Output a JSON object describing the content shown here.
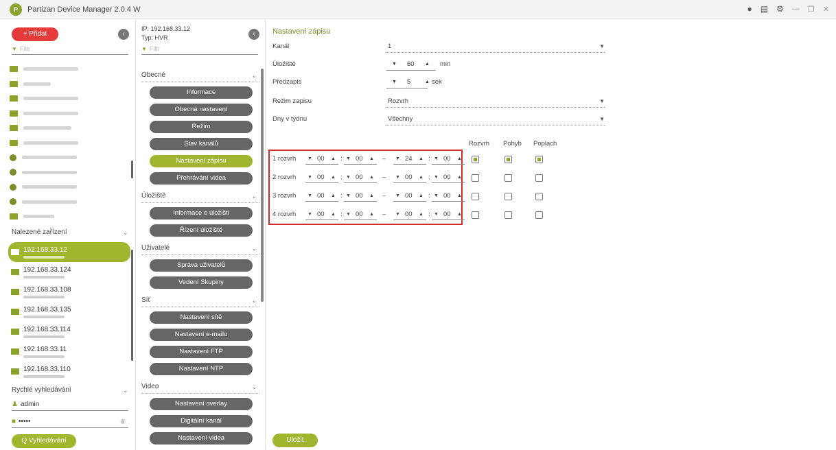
{
  "titlebar": {
    "logo_text": "P",
    "title": "Partizan Device Manager 2.0.4 W"
  },
  "left": {
    "add_label": "+  Přidat",
    "filter_placeholder": "Filtr",
    "found_title": "Nalezené zařízení",
    "found": [
      {
        "ip": "192.168.33.12"
      },
      {
        "ip": "192.168.33.124"
      },
      {
        "ip": "192.168.33.108"
      },
      {
        "ip": "192.168.33.135"
      },
      {
        "ip": "192.168.33.114"
      },
      {
        "ip": "192.168.33.11"
      },
      {
        "ip": "192.168.33.110"
      }
    ],
    "quick_title": "Rychlé vyhledávání",
    "username": "admin",
    "password_mask": "•••••",
    "search_label": "Q  Vyhledávání"
  },
  "middle": {
    "ip_line": "IP:    192.168.33.12",
    "type_line": "Typ:   HVR",
    "filter_placeholder": "Filtr",
    "groups": {
      "obecne": "Obecné",
      "uloziste": "Úložiště",
      "uzivatele": "Uživatelé",
      "sit": "Síť",
      "video": "Video"
    },
    "buttons": {
      "informace": "Informace",
      "obecna": "Obecná nastavení",
      "rezim": "Režim",
      "stav": "Stav kanálů",
      "zapisu": "Nastavení zápisu",
      "prehravani": "Přehrávání videa",
      "info_ulozisti": "Informace o úložišti",
      "rizeni": "Řízení úložiště",
      "sprava": "Správa uživatelů",
      "skupiny": "Vedení Skupiny",
      "site": "Nastavení sítě",
      "email": "Nastavení e-mailu",
      "ftp": "Nastavení FTP",
      "ntp": "Nastavení NTP",
      "overlay": "Nastavení overlay",
      "digital": "Digitální kanál",
      "video_set": "Nastavení videa"
    }
  },
  "main": {
    "title": "Nastavení zápisu",
    "kanal_label": "Kanál",
    "kanal_value": "1",
    "uloziste_label": "Úložiště",
    "uloziste_value": "60",
    "uloziste_unit": "min",
    "predzapis_label": "Předzapis",
    "predzapis_value": "5",
    "predzapis_unit": "sek",
    "rezim_label": "Režim zapisu",
    "rezim_value": "Rozvrh",
    "dny_label": "Dny v týdnu",
    "dny_value": "Všechny",
    "col_headers": {
      "rozvrh": "Rozvrh",
      "pohyb": "Pohyb",
      "poplach": "Poplach"
    },
    "schedules": [
      {
        "label": "1 rozvrh",
        "sh": "00",
        "sm": "00",
        "eh": "24",
        "em": "00",
        "rozvrh": true,
        "pohyb": true,
        "poplach": true
      },
      {
        "label": "2 rozvrh",
        "sh": "00",
        "sm": "00",
        "eh": "00",
        "em": "00",
        "rozvrh": false,
        "pohyb": false,
        "poplach": false
      },
      {
        "label": "3 rozvrh",
        "sh": "00",
        "sm": "00",
        "eh": "00",
        "em": "00",
        "rozvrh": false,
        "pohyb": false,
        "poplach": false
      },
      {
        "label": "4 rozvrh",
        "sh": "00",
        "sm": "00",
        "eh": "00",
        "em": "00",
        "rozvrh": false,
        "pohyb": false,
        "poplach": false
      }
    ],
    "save_label": "Uložit"
  }
}
